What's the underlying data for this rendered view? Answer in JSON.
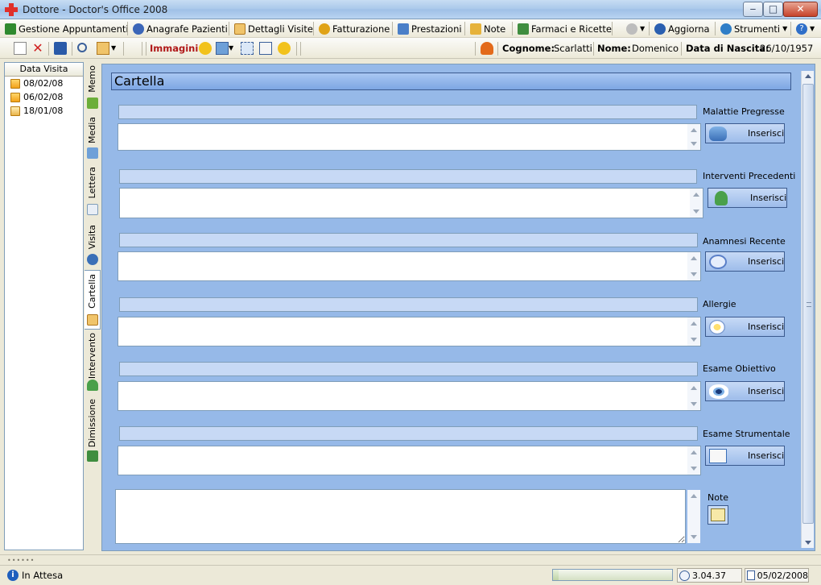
{
  "window": {
    "title": "Dottore - Doctor's Office 2008",
    "minimize": "‒",
    "maximize": "□",
    "close": "✕"
  },
  "menu": {
    "items": [
      {
        "label": "Gestione Appuntamenti",
        "icon": "calendar-book-icon",
        "color": "#2f8a2f"
      },
      {
        "label": "Anagrafe Pazienti",
        "icon": "patients-icon",
        "color": "#3b66b8"
      },
      {
        "label": "Dettagli Visite",
        "icon": "clipboard-icon",
        "color": "#d98a1a"
      },
      {
        "label": "Fatturazione",
        "icon": "coin-icon",
        "color": "#e0a317"
      },
      {
        "label": "Prestazioni",
        "icon": "services-icon",
        "color": "#4a7fc8"
      },
      {
        "label": "Note",
        "icon": "note-icon",
        "color": "#e6b23a"
      },
      {
        "label": "Farmaci e Ricette",
        "icon": "prescription-icon",
        "color": "#3f8d3f"
      },
      {
        "label": "",
        "icon": "phone-icon",
        "color": "#9a9a9a"
      },
      {
        "label": "Aggiorna",
        "icon": "update-globe-icon",
        "color": "#2a5fb0"
      },
      {
        "label": "Strumenti",
        "icon": "tools-icon",
        "color": "#2f7ec7"
      },
      {
        "label": "",
        "icon": "help-icon",
        "color": "#2f6fc8"
      }
    ]
  },
  "toolbar": {
    "section_label": "Immagini",
    "cognome_label": "Cognome:",
    "cognome_value": "Scarlatti",
    "nome_label": "Nome:",
    "nome_value": "Domenico",
    "nascita_label": "Data di Nascita:",
    "nascita_value": "26/10/1957"
  },
  "visits": {
    "header": "Data Visita",
    "rows": [
      "08/02/08",
      "06/02/08",
      "18/01/08"
    ]
  },
  "tabs": [
    {
      "label": "Memo",
      "icon": "memo-pencil-icon"
    },
    {
      "label": "Media",
      "icon": "image-icon"
    },
    {
      "label": "Lettera",
      "icon": "letter-icon"
    },
    {
      "label": "Visita",
      "icon": "stethoscope-icon"
    },
    {
      "label": "Cartella",
      "icon": "folder-icon"
    },
    {
      "label": "Intervento",
      "icon": "surgeon-icon"
    },
    {
      "label": "Dimissione",
      "icon": "discharge-icon"
    }
  ],
  "panel": {
    "title": "Cartella",
    "insert_label": "Inserisci",
    "sections": [
      {
        "label": "Malattie Pregresse",
        "icon": "disease-icon"
      },
      {
        "label": "Interventi Precedenti",
        "icon": "person-icon"
      },
      {
        "label": "Anamnesi Recente",
        "icon": "speech-bubble-icon"
      },
      {
        "label": "Allergie",
        "icon": "flower-icon"
      },
      {
        "label": "Esame Obiettivo",
        "icon": "eye-icon"
      },
      {
        "label": "Esame Strumentale",
        "icon": "chart-icon"
      }
    ],
    "note_label": "Note"
  },
  "status": {
    "text": "In Attesa",
    "progress": 0.05,
    "version": "3.04.37",
    "date": "05/02/2008"
  }
}
